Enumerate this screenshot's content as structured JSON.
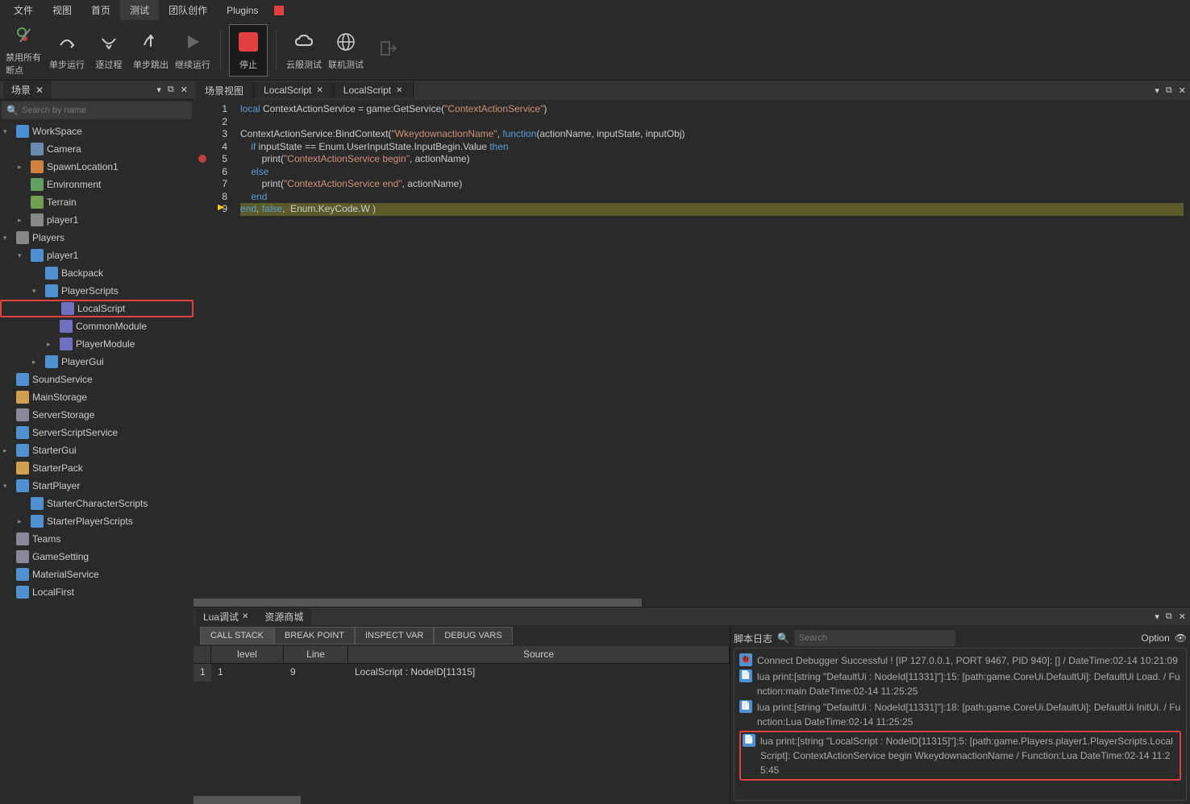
{
  "menu": [
    "文件",
    "视图",
    "首页",
    "测试",
    "团队创作",
    "Plugins"
  ],
  "menu_active": 3,
  "toolbar": [
    {
      "label": "禁用所有断点",
      "icon": "breakpoints-off"
    },
    {
      "label": "单步运行",
      "icon": "step-over"
    },
    {
      "label": "逐过程",
      "icon": "step-into"
    },
    {
      "label": "单步跳出",
      "icon": "step-out"
    },
    {
      "label": "继续运行",
      "icon": "play"
    },
    {
      "label": "停止",
      "icon": "stop"
    },
    {
      "label": "云服测试",
      "icon": "cloud"
    },
    {
      "label": "联机测试",
      "icon": "globe"
    },
    {
      "label": "",
      "icon": "exit"
    }
  ],
  "scene_panel": {
    "title": "场景",
    "search_placeholder": "Search by name"
  },
  "tree": [
    {
      "indent": 0,
      "arrow": "▾",
      "icon": "#4a90d0",
      "label": "WorkSpace"
    },
    {
      "indent": 1,
      "arrow": "",
      "icon": "#6a8ab0",
      "label": "Camera"
    },
    {
      "indent": 1,
      "arrow": "▸",
      "icon": "#d08040",
      "label": "SpawnLocation1"
    },
    {
      "indent": 1,
      "arrow": "",
      "icon": "#60a060",
      "label": "Environment"
    },
    {
      "indent": 1,
      "arrow": "",
      "icon": "#70a050",
      "label": "Terrain"
    },
    {
      "indent": 1,
      "arrow": "▸",
      "icon": "#888",
      "label": "player1"
    },
    {
      "indent": 0,
      "arrow": "▾",
      "icon": "#888",
      "label": "Players"
    },
    {
      "indent": 1,
      "arrow": "▾",
      "icon": "#5090d0",
      "label": "player1"
    },
    {
      "indent": 2,
      "arrow": "",
      "icon": "#5090d0",
      "label": "Backpack"
    },
    {
      "indent": 2,
      "arrow": "▾",
      "icon": "#5090d0",
      "label": "PlayerScripts"
    },
    {
      "indent": 3,
      "arrow": "",
      "icon": "#7070c0",
      "label": "LocalScript",
      "highlighted": true
    },
    {
      "indent": 3,
      "arrow": "",
      "icon": "#7070c0",
      "label": "CommonModule"
    },
    {
      "indent": 3,
      "arrow": "▸",
      "icon": "#7070c0",
      "label": "PlayerModule"
    },
    {
      "indent": 2,
      "arrow": "▸",
      "icon": "#5090d0",
      "label": "PlayerGui"
    },
    {
      "indent": 0,
      "arrow": "",
      "icon": "#5090d0",
      "label": "SoundService"
    },
    {
      "indent": 0,
      "arrow": "",
      "icon": "#d0a050",
      "label": "MainStorage"
    },
    {
      "indent": 0,
      "arrow": "",
      "icon": "#889",
      "label": "ServerStorage"
    },
    {
      "indent": 0,
      "arrow": "",
      "icon": "#5090d0",
      "label": "ServerScriptService"
    },
    {
      "indent": 0,
      "arrow": "▸",
      "icon": "#5090d0",
      "label": "StarterGui"
    },
    {
      "indent": 0,
      "arrow": "",
      "icon": "#d0a050",
      "label": "StarterPack"
    },
    {
      "indent": 0,
      "arrow": "▾",
      "icon": "#5090d0",
      "label": "StartPlayer"
    },
    {
      "indent": 1,
      "arrow": "",
      "icon": "#5090d0",
      "label": "StarterCharacterScripts"
    },
    {
      "indent": 1,
      "arrow": "▸",
      "icon": "#5090d0",
      "label": "StarterPlayerScripts"
    },
    {
      "indent": 0,
      "arrow": "",
      "icon": "#889",
      "label": "Teams"
    },
    {
      "indent": 0,
      "arrow": "",
      "icon": "#889",
      "label": "GameSetting"
    },
    {
      "indent": 0,
      "arrow": "",
      "icon": "#5090d0",
      "label": "MaterialService"
    },
    {
      "indent": 0,
      "arrow": "",
      "icon": "#5090d0",
      "label": "LocalFirst"
    }
  ],
  "editor_tabs": [
    "场景视图",
    "LocalScript",
    "LocalScript"
  ],
  "code_lines": [
    [
      {
        "t": "local ",
        "c": "kw"
      },
      {
        "t": "ContextActionService = game:GetService("
      },
      {
        "t": "\"ContextActionService\"",
        "c": "str"
      },
      {
        "t": ")"
      }
    ],
    [],
    [
      {
        "t": "ContextActionService:BindContext("
      },
      {
        "t": "\"WkeydownactionName\"",
        "c": "str"
      },
      {
        "t": ", "
      },
      {
        "t": "function",
        "c": "kw"
      },
      {
        "t": "(actionName, inputState, inputObj)"
      }
    ],
    [
      {
        "t": "    "
      },
      {
        "t": "if",
        "c": "kw"
      },
      {
        "t": " inputState == Enum.UserInputState.InputBegin.Value "
      },
      {
        "t": "then",
        "c": "kw"
      }
    ],
    [
      {
        "t": "        print("
      },
      {
        "t": "\"ContextActionService begin\"",
        "c": "str"
      },
      {
        "t": ", actionName)"
      }
    ],
    [
      {
        "t": "    "
      },
      {
        "t": "else",
        "c": "kw"
      }
    ],
    [
      {
        "t": "        print("
      },
      {
        "t": "\"ContextActionService end\"",
        "c": "str"
      },
      {
        "t": ", actionName)"
      }
    ],
    [
      {
        "t": "    "
      },
      {
        "t": "end",
        "c": "kw"
      }
    ],
    [
      {
        "t": "end",
        "c": "kw"
      },
      {
        "t": ", "
      },
      {
        "t": "false",
        "c": "kw"
      },
      {
        "t": ",  Enum.KeyCode.W )"
      }
    ]
  ],
  "breakpoint_line": 5,
  "current_line": 9,
  "bottom_tabs": [
    "Lua调试",
    "资源商城"
  ],
  "debug_sub_tabs": [
    "CALL STACK",
    "BREAK POINT",
    "INSPECT VAR",
    "DEBUG VARS"
  ],
  "callstack": {
    "headers": {
      "idx": "",
      "level": "level",
      "line": "Line",
      "source": "Source"
    },
    "rows": [
      {
        "idx": "1",
        "level": "1",
        "line": "9",
        "source": "LocalScript : NodeID[11315]"
      }
    ]
  },
  "log": {
    "title": "脚本日志",
    "search_placeholder": "Search",
    "option_label": "Option",
    "entries": [
      {
        "icon": "debug",
        "color": "#5090d0",
        "text": "Connect Debugger Successful ! [IP 127.0.0.1, PORT 9467, PID 940]: [] / DateTime:02-14 10:21:09"
      },
      {
        "icon": "script",
        "color": "#5090d0",
        "text": "lua print:[string \"DefaultUi : NodeId[11331]\"]:15: [path:game.CoreUi.DefaultUi]: DefaultUi Load. / Function:main DateTime:02-14 11:25:25"
      },
      {
        "icon": "script",
        "color": "#5090d0",
        "text": "lua print:[string \"DefaultUi : NodeId[11331]\"]:18: [path:game.CoreUi.DefaultUi]: DefaultUi InitUi. / Function:Lua DateTime:02-14 11:25:25"
      },
      {
        "icon": "script",
        "color": "#5090d0",
        "text": "lua print:[string \"LocalScript : NodeID[11315]\"]:5: [path:game.Players.player1.PlayerScripts.LocalScript]: ContextActionService begin WkeydownactionName / Function:Lua DateTime:02-14 11:25:45",
        "highlighted": true
      }
    ]
  }
}
